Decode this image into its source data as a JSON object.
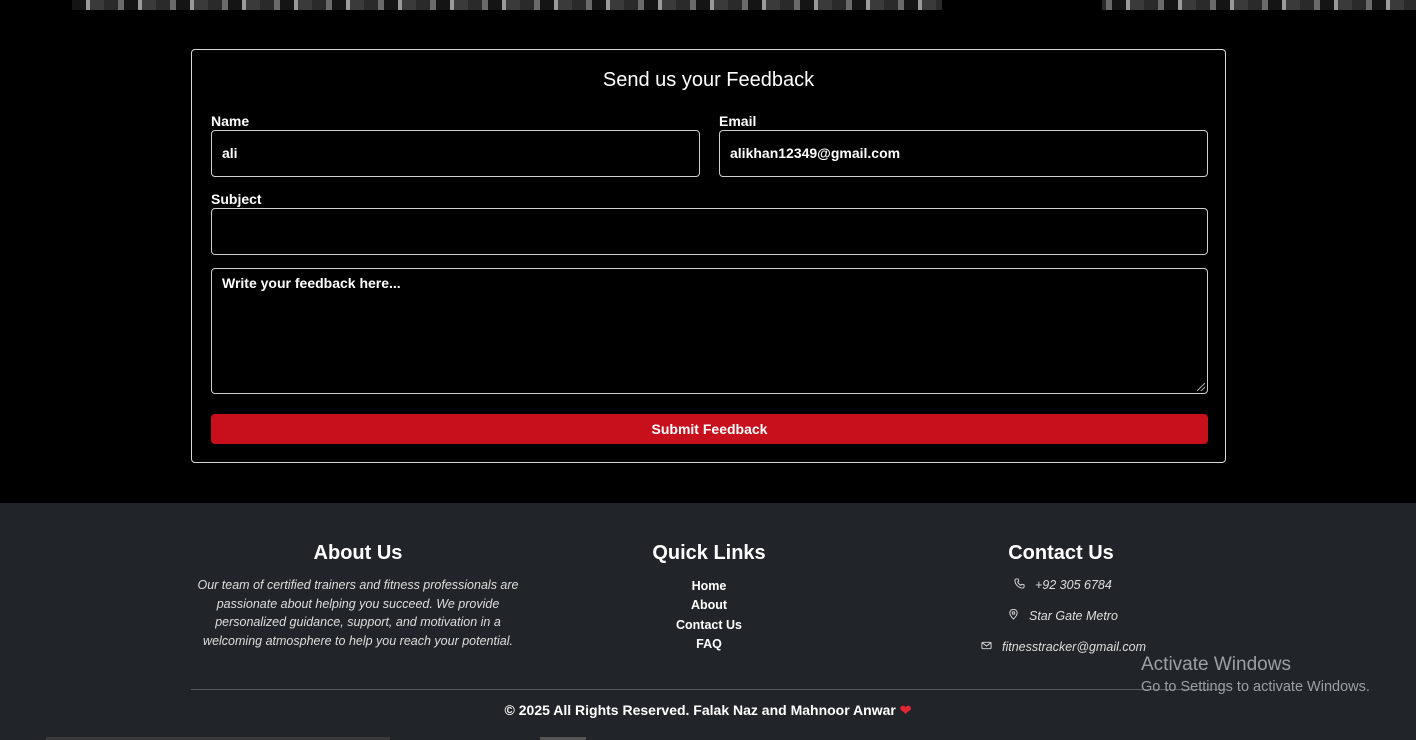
{
  "feedback": {
    "title": "Send us your Feedback",
    "name_label": "Name",
    "name_value": "ali",
    "email_label": "Email",
    "email_value": "alikhan12349@gmail.com",
    "subject_label": "Subject",
    "subject_value": "",
    "message_placeholder": "Write your feedback here...",
    "submit_label": "Submit Feedback"
  },
  "footer": {
    "about_title": "About Us",
    "about_text": "Our team of certified trainers and fitness professionals are passionate about helping you succeed. We provide personalized guidance, support, and motivation in a welcoming atmosphere to help you reach your potential.",
    "links_title": "Quick Links",
    "links": [
      "Home",
      "About",
      "Contact Us",
      "FAQ"
    ],
    "contact_title": "Contact Us",
    "phone": "+92 305 6784",
    "address": "Star Gate Metro",
    "email": "fitnesstracker@gmail.com",
    "copyright": "© 2025 All Rights Reserved. Falak Naz and Mahnoor Anwar",
    "heart_icon": "heart-icon",
    "accent_color": "#c8101c"
  },
  "os_overlay": {
    "activate_title": "Activate Windows",
    "activate_sub": "Go to Settings to activate Windows."
  }
}
